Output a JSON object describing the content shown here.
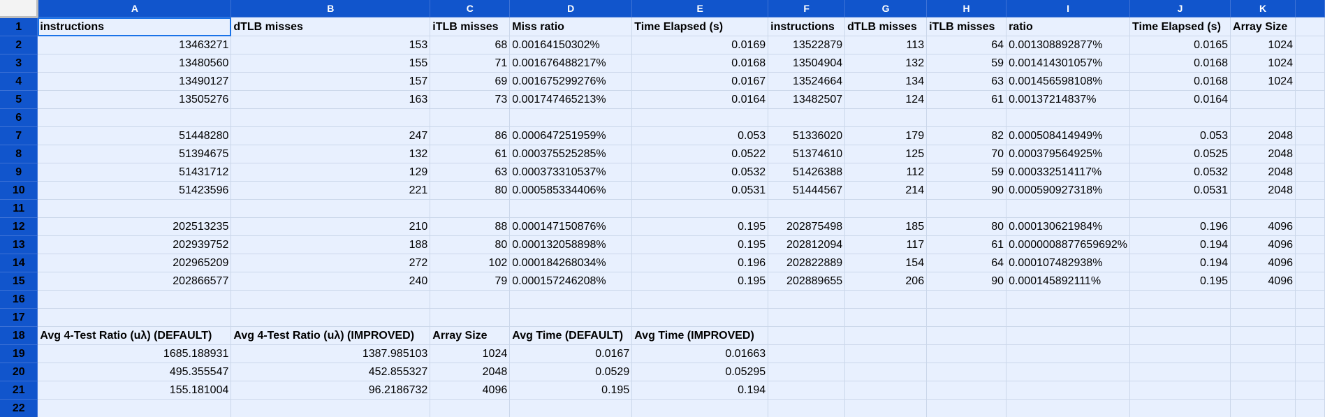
{
  "columns": [
    "A",
    "B",
    "C",
    "D",
    "E",
    "F",
    "G",
    "H",
    "I",
    "J",
    "K",
    ""
  ],
  "rows": [
    {
      "n": "1",
      "cells": [
        {
          "v": "instructions",
          "t": "txt",
          "b": true
        },
        {
          "v": "dTLB misses",
          "t": "txt",
          "b": true
        },
        {
          "v": "iTLB misses",
          "t": "txt",
          "b": true
        },
        {
          "v": "Miss ratio",
          "t": "txt",
          "b": true
        },
        {
          "v": "Time Elapsed (s)",
          "t": "txt",
          "b": true
        },
        {
          "v": "instructions",
          "t": "txt",
          "b": true
        },
        {
          "v": "dTLB misses",
          "t": "txt",
          "b": true
        },
        {
          "v": "iTLB misses",
          "t": "txt",
          "b": true
        },
        {
          "v": "ratio",
          "t": "txt",
          "b": true
        },
        {
          "v": "Time Elapsed (s)",
          "t": "txt",
          "b": true
        },
        {
          "v": "Array Size",
          "t": "txt",
          "b": true
        },
        {
          "v": "",
          "t": "txt"
        }
      ]
    },
    {
      "n": "2",
      "cells": [
        {
          "v": "13463271",
          "t": "num"
        },
        {
          "v": "153",
          "t": "num"
        },
        {
          "v": "68",
          "t": "num"
        },
        {
          "v": "0.00164150302%",
          "t": "txt"
        },
        {
          "v": "0.0169",
          "t": "num"
        },
        {
          "v": "13522879",
          "t": "num"
        },
        {
          "v": "113",
          "t": "num"
        },
        {
          "v": "64",
          "t": "num"
        },
        {
          "v": "0.001308892877%",
          "t": "txt"
        },
        {
          "v": "0.0165",
          "t": "num"
        },
        {
          "v": "1024",
          "t": "num"
        },
        {
          "v": "",
          "t": "txt"
        }
      ]
    },
    {
      "n": "3",
      "cells": [
        {
          "v": "13480560",
          "t": "num"
        },
        {
          "v": "155",
          "t": "num"
        },
        {
          "v": "71",
          "t": "num"
        },
        {
          "v": "0.001676488217%",
          "t": "txt"
        },
        {
          "v": "0.0168",
          "t": "num"
        },
        {
          "v": "13504904",
          "t": "num"
        },
        {
          "v": "132",
          "t": "num"
        },
        {
          "v": "59",
          "t": "num"
        },
        {
          "v": "0.001414301057%",
          "t": "txt"
        },
        {
          "v": "0.0168",
          "t": "num"
        },
        {
          "v": "1024",
          "t": "num"
        },
        {
          "v": "",
          "t": "txt"
        }
      ]
    },
    {
      "n": "4",
      "cells": [
        {
          "v": "13490127",
          "t": "num"
        },
        {
          "v": "157",
          "t": "num"
        },
        {
          "v": "69",
          "t": "num"
        },
        {
          "v": "0.001675299276%",
          "t": "txt"
        },
        {
          "v": "0.0167",
          "t": "num"
        },
        {
          "v": "13524664",
          "t": "num"
        },
        {
          "v": "134",
          "t": "num"
        },
        {
          "v": "63",
          "t": "num"
        },
        {
          "v": "0.001456598108%",
          "t": "txt"
        },
        {
          "v": "0.0168",
          "t": "num"
        },
        {
          "v": "1024",
          "t": "num"
        },
        {
          "v": "",
          "t": "txt"
        }
      ]
    },
    {
      "n": "5",
      "cells": [
        {
          "v": "13505276",
          "t": "num"
        },
        {
          "v": "163",
          "t": "num"
        },
        {
          "v": "73",
          "t": "num"
        },
        {
          "v": "0.001747465213%",
          "t": "txt"
        },
        {
          "v": "0.0164",
          "t": "num"
        },
        {
          "v": "13482507",
          "t": "num"
        },
        {
          "v": "124",
          "t": "num"
        },
        {
          "v": "61",
          "t": "num"
        },
        {
          "v": "0.00137214837%",
          "t": "txt"
        },
        {
          "v": "0.0164",
          "t": "num"
        },
        {
          "v": "",
          "t": "num"
        },
        {
          "v": "",
          "t": "txt"
        }
      ]
    },
    {
      "n": "6",
      "cells": [
        {
          "v": "",
          "t": "txt"
        },
        {
          "v": "",
          "t": "txt"
        },
        {
          "v": "",
          "t": "txt"
        },
        {
          "v": "",
          "t": "txt"
        },
        {
          "v": "",
          "t": "txt"
        },
        {
          "v": "",
          "t": "txt"
        },
        {
          "v": "",
          "t": "txt"
        },
        {
          "v": "",
          "t": "txt"
        },
        {
          "v": "",
          "t": "txt"
        },
        {
          "v": "",
          "t": "txt"
        },
        {
          "v": "",
          "t": "txt"
        },
        {
          "v": "",
          "t": "txt"
        }
      ]
    },
    {
      "n": "7",
      "cells": [
        {
          "v": "51448280",
          "t": "num"
        },
        {
          "v": "247",
          "t": "num"
        },
        {
          "v": "86",
          "t": "num"
        },
        {
          "v": "0.000647251959%",
          "t": "txt"
        },
        {
          "v": "0.053",
          "t": "num"
        },
        {
          "v": "51336020",
          "t": "num"
        },
        {
          "v": "179",
          "t": "num"
        },
        {
          "v": "82",
          "t": "num"
        },
        {
          "v": "0.000508414949%",
          "t": "txt"
        },
        {
          "v": "0.053",
          "t": "num"
        },
        {
          "v": "2048",
          "t": "num"
        },
        {
          "v": "",
          "t": "txt"
        }
      ]
    },
    {
      "n": "8",
      "cells": [
        {
          "v": "51394675",
          "t": "num"
        },
        {
          "v": "132",
          "t": "num"
        },
        {
          "v": "61",
          "t": "num"
        },
        {
          "v": "0.000375525285%",
          "t": "txt"
        },
        {
          "v": "0.0522",
          "t": "num"
        },
        {
          "v": "51374610",
          "t": "num"
        },
        {
          "v": "125",
          "t": "num"
        },
        {
          "v": "70",
          "t": "num"
        },
        {
          "v": "0.000379564925%",
          "t": "txt"
        },
        {
          "v": "0.0525",
          "t": "num"
        },
        {
          "v": "2048",
          "t": "num"
        },
        {
          "v": "",
          "t": "txt"
        }
      ]
    },
    {
      "n": "9",
      "cells": [
        {
          "v": "51431712",
          "t": "num"
        },
        {
          "v": "129",
          "t": "num"
        },
        {
          "v": "63",
          "t": "num"
        },
        {
          "v": "0.000373310537%",
          "t": "txt"
        },
        {
          "v": "0.0532",
          "t": "num"
        },
        {
          "v": "51426388",
          "t": "num"
        },
        {
          "v": "112",
          "t": "num"
        },
        {
          "v": "59",
          "t": "num"
        },
        {
          "v": "0.000332514117%",
          "t": "txt"
        },
        {
          "v": "0.0532",
          "t": "num"
        },
        {
          "v": "2048",
          "t": "num"
        },
        {
          "v": "",
          "t": "txt"
        }
      ]
    },
    {
      "n": "10",
      "cells": [
        {
          "v": "51423596",
          "t": "num"
        },
        {
          "v": "221",
          "t": "num"
        },
        {
          "v": "80",
          "t": "num"
        },
        {
          "v": "0.000585334406%",
          "t": "txt"
        },
        {
          "v": "0.0531",
          "t": "num"
        },
        {
          "v": "51444567",
          "t": "num"
        },
        {
          "v": "214",
          "t": "num"
        },
        {
          "v": "90",
          "t": "num"
        },
        {
          "v": "0.000590927318%",
          "t": "txt"
        },
        {
          "v": "0.0531",
          "t": "num"
        },
        {
          "v": "2048",
          "t": "num"
        },
        {
          "v": "",
          "t": "txt"
        }
      ]
    },
    {
      "n": "11",
      "cells": [
        {
          "v": "",
          "t": "txt"
        },
        {
          "v": "",
          "t": "txt"
        },
        {
          "v": "",
          "t": "txt"
        },
        {
          "v": "",
          "t": "txt"
        },
        {
          "v": "",
          "t": "txt"
        },
        {
          "v": "",
          "t": "txt"
        },
        {
          "v": "",
          "t": "txt"
        },
        {
          "v": "",
          "t": "txt"
        },
        {
          "v": "",
          "t": "txt"
        },
        {
          "v": "",
          "t": "txt"
        },
        {
          "v": "",
          "t": "txt"
        },
        {
          "v": "",
          "t": "txt"
        }
      ]
    },
    {
      "n": "12",
      "cells": [
        {
          "v": "202513235",
          "t": "num"
        },
        {
          "v": "210",
          "t": "num"
        },
        {
          "v": "88",
          "t": "num"
        },
        {
          "v": "0.000147150876%",
          "t": "txt"
        },
        {
          "v": "0.195",
          "t": "num"
        },
        {
          "v": "202875498",
          "t": "num"
        },
        {
          "v": "185",
          "t": "num"
        },
        {
          "v": "80",
          "t": "num"
        },
        {
          "v": "0.000130621984%",
          "t": "txt"
        },
        {
          "v": "0.196",
          "t": "num"
        },
        {
          "v": "4096",
          "t": "num"
        },
        {
          "v": "",
          "t": "txt"
        }
      ]
    },
    {
      "n": "13",
      "cells": [
        {
          "v": "202939752",
          "t": "num"
        },
        {
          "v": "188",
          "t": "num"
        },
        {
          "v": "80",
          "t": "num"
        },
        {
          "v": "0.000132058898%",
          "t": "txt"
        },
        {
          "v": "0.195",
          "t": "num"
        },
        {
          "v": "202812094",
          "t": "num"
        },
        {
          "v": "117",
          "t": "num"
        },
        {
          "v": "61",
          "t": "num"
        },
        {
          "v": "0.0000008877659692%",
          "t": "txt"
        },
        {
          "v": "0.194",
          "t": "num"
        },
        {
          "v": "4096",
          "t": "num"
        },
        {
          "v": "",
          "t": "txt"
        }
      ]
    },
    {
      "n": "14",
      "cells": [
        {
          "v": "202965209",
          "t": "num"
        },
        {
          "v": "272",
          "t": "num"
        },
        {
          "v": "102",
          "t": "num"
        },
        {
          "v": "0.000184268034%",
          "t": "txt"
        },
        {
          "v": "0.196",
          "t": "num"
        },
        {
          "v": "202822889",
          "t": "num"
        },
        {
          "v": "154",
          "t": "num"
        },
        {
          "v": "64",
          "t": "num"
        },
        {
          "v": "0.000107482938%",
          "t": "txt"
        },
        {
          "v": "0.194",
          "t": "num"
        },
        {
          "v": "4096",
          "t": "num"
        },
        {
          "v": "",
          "t": "txt"
        }
      ]
    },
    {
      "n": "15",
      "cells": [
        {
          "v": "202866577",
          "t": "num"
        },
        {
          "v": "240",
          "t": "num"
        },
        {
          "v": "79",
          "t": "num"
        },
        {
          "v": "0.000157246208%",
          "t": "txt"
        },
        {
          "v": "0.195",
          "t": "num"
        },
        {
          "v": "202889655",
          "t": "num"
        },
        {
          "v": "206",
          "t": "num"
        },
        {
          "v": "90",
          "t": "num"
        },
        {
          "v": "0.000145892111%",
          "t": "txt"
        },
        {
          "v": "0.195",
          "t": "num"
        },
        {
          "v": "4096",
          "t": "num"
        },
        {
          "v": "",
          "t": "txt"
        }
      ]
    },
    {
      "n": "16",
      "cells": [
        {
          "v": "",
          "t": "txt"
        },
        {
          "v": "",
          "t": "txt"
        },
        {
          "v": "",
          "t": "txt"
        },
        {
          "v": "",
          "t": "txt"
        },
        {
          "v": "",
          "t": "txt"
        },
        {
          "v": "",
          "t": "txt"
        },
        {
          "v": "",
          "t": "txt"
        },
        {
          "v": "",
          "t": "txt"
        },
        {
          "v": "",
          "t": "txt"
        },
        {
          "v": "",
          "t": "txt"
        },
        {
          "v": "",
          "t": "txt"
        },
        {
          "v": "",
          "t": "txt"
        }
      ]
    },
    {
      "n": "17",
      "cells": [
        {
          "v": "",
          "t": "txt"
        },
        {
          "v": "",
          "t": "txt"
        },
        {
          "v": "",
          "t": "txt"
        },
        {
          "v": "",
          "t": "txt"
        },
        {
          "v": "",
          "t": "txt"
        },
        {
          "v": "",
          "t": "txt"
        },
        {
          "v": "",
          "t": "txt"
        },
        {
          "v": "",
          "t": "txt"
        },
        {
          "v": "",
          "t": "txt"
        },
        {
          "v": "",
          "t": "txt"
        },
        {
          "v": "",
          "t": "txt"
        },
        {
          "v": "",
          "t": "txt"
        }
      ]
    },
    {
      "n": "18",
      "cells": [
        {
          "v": "Avg 4-Test Ratio (uλ) (DEFAULT)",
          "t": "txt",
          "b": true
        },
        {
          "v": "Avg 4-Test Ratio (uλ) (IMPROVED)",
          "t": "txt",
          "b": true
        },
        {
          "v": "Array Size",
          "t": "txt",
          "b": true
        },
        {
          "v": "Avg Time (DEFAULT)",
          "t": "txt",
          "b": true
        },
        {
          "v": "Avg Time (IMPROVED)",
          "t": "txt",
          "b": true
        },
        {
          "v": "",
          "t": "txt"
        },
        {
          "v": "",
          "t": "txt"
        },
        {
          "v": "",
          "t": "txt"
        },
        {
          "v": "",
          "t": "txt"
        },
        {
          "v": "",
          "t": "txt"
        },
        {
          "v": "",
          "t": "txt"
        },
        {
          "v": "",
          "t": "txt"
        }
      ]
    },
    {
      "n": "19",
      "cells": [
        {
          "v": "1685.188931",
          "t": "num"
        },
        {
          "v": "1387.985103",
          "t": "num"
        },
        {
          "v": "1024",
          "t": "num"
        },
        {
          "v": "0.0167",
          "t": "num"
        },
        {
          "v": "0.01663",
          "t": "num"
        },
        {
          "v": "",
          "t": "txt"
        },
        {
          "v": "",
          "t": "txt"
        },
        {
          "v": "",
          "t": "txt"
        },
        {
          "v": "",
          "t": "txt"
        },
        {
          "v": "",
          "t": "txt"
        },
        {
          "v": "",
          "t": "txt"
        },
        {
          "v": "",
          "t": "txt"
        }
      ]
    },
    {
      "n": "20",
      "cells": [
        {
          "v": "495.355547",
          "t": "num"
        },
        {
          "v": "452.855327",
          "t": "num"
        },
        {
          "v": "2048",
          "t": "num"
        },
        {
          "v": "0.0529",
          "t": "num"
        },
        {
          "v": "0.05295",
          "t": "num"
        },
        {
          "v": "",
          "t": "txt"
        },
        {
          "v": "",
          "t": "txt"
        },
        {
          "v": "",
          "t": "txt"
        },
        {
          "v": "",
          "t": "txt"
        },
        {
          "v": "",
          "t": "txt"
        },
        {
          "v": "",
          "t": "txt"
        },
        {
          "v": "",
          "t": "txt"
        }
      ]
    },
    {
      "n": "21",
      "cells": [
        {
          "v": "155.181004",
          "t": "num"
        },
        {
          "v": "96.2186732",
          "t": "num"
        },
        {
          "v": "4096",
          "t": "num"
        },
        {
          "v": "0.195",
          "t": "num"
        },
        {
          "v": "0.194",
          "t": "num"
        },
        {
          "v": "",
          "t": "txt"
        },
        {
          "v": "",
          "t": "txt"
        },
        {
          "v": "",
          "t": "txt"
        },
        {
          "v": "",
          "t": "txt"
        },
        {
          "v": "",
          "t": "txt"
        },
        {
          "v": "",
          "t": "txt"
        },
        {
          "v": "",
          "t": "txt"
        }
      ]
    },
    {
      "n": "22",
      "cells": [
        {
          "v": "",
          "t": "txt"
        },
        {
          "v": "",
          "t": "txt"
        },
        {
          "v": "",
          "t": "txt"
        },
        {
          "v": "",
          "t": "txt"
        },
        {
          "v": "",
          "t": "txt"
        },
        {
          "v": "",
          "t": "txt"
        },
        {
          "v": "",
          "t": "txt"
        },
        {
          "v": "",
          "t": "txt"
        },
        {
          "v": "",
          "t": "txt"
        },
        {
          "v": "",
          "t": "txt"
        },
        {
          "v": "",
          "t": "txt"
        },
        {
          "v": "",
          "t": "txt"
        }
      ]
    }
  ],
  "selected_cell": "A1",
  "colors": {
    "header_bg": "#1155cc",
    "header_text": "#ffffff",
    "cell_bg": "#e8f0fe",
    "cell_border": "#cbd7ea",
    "selection": "#1a73e8"
  }
}
